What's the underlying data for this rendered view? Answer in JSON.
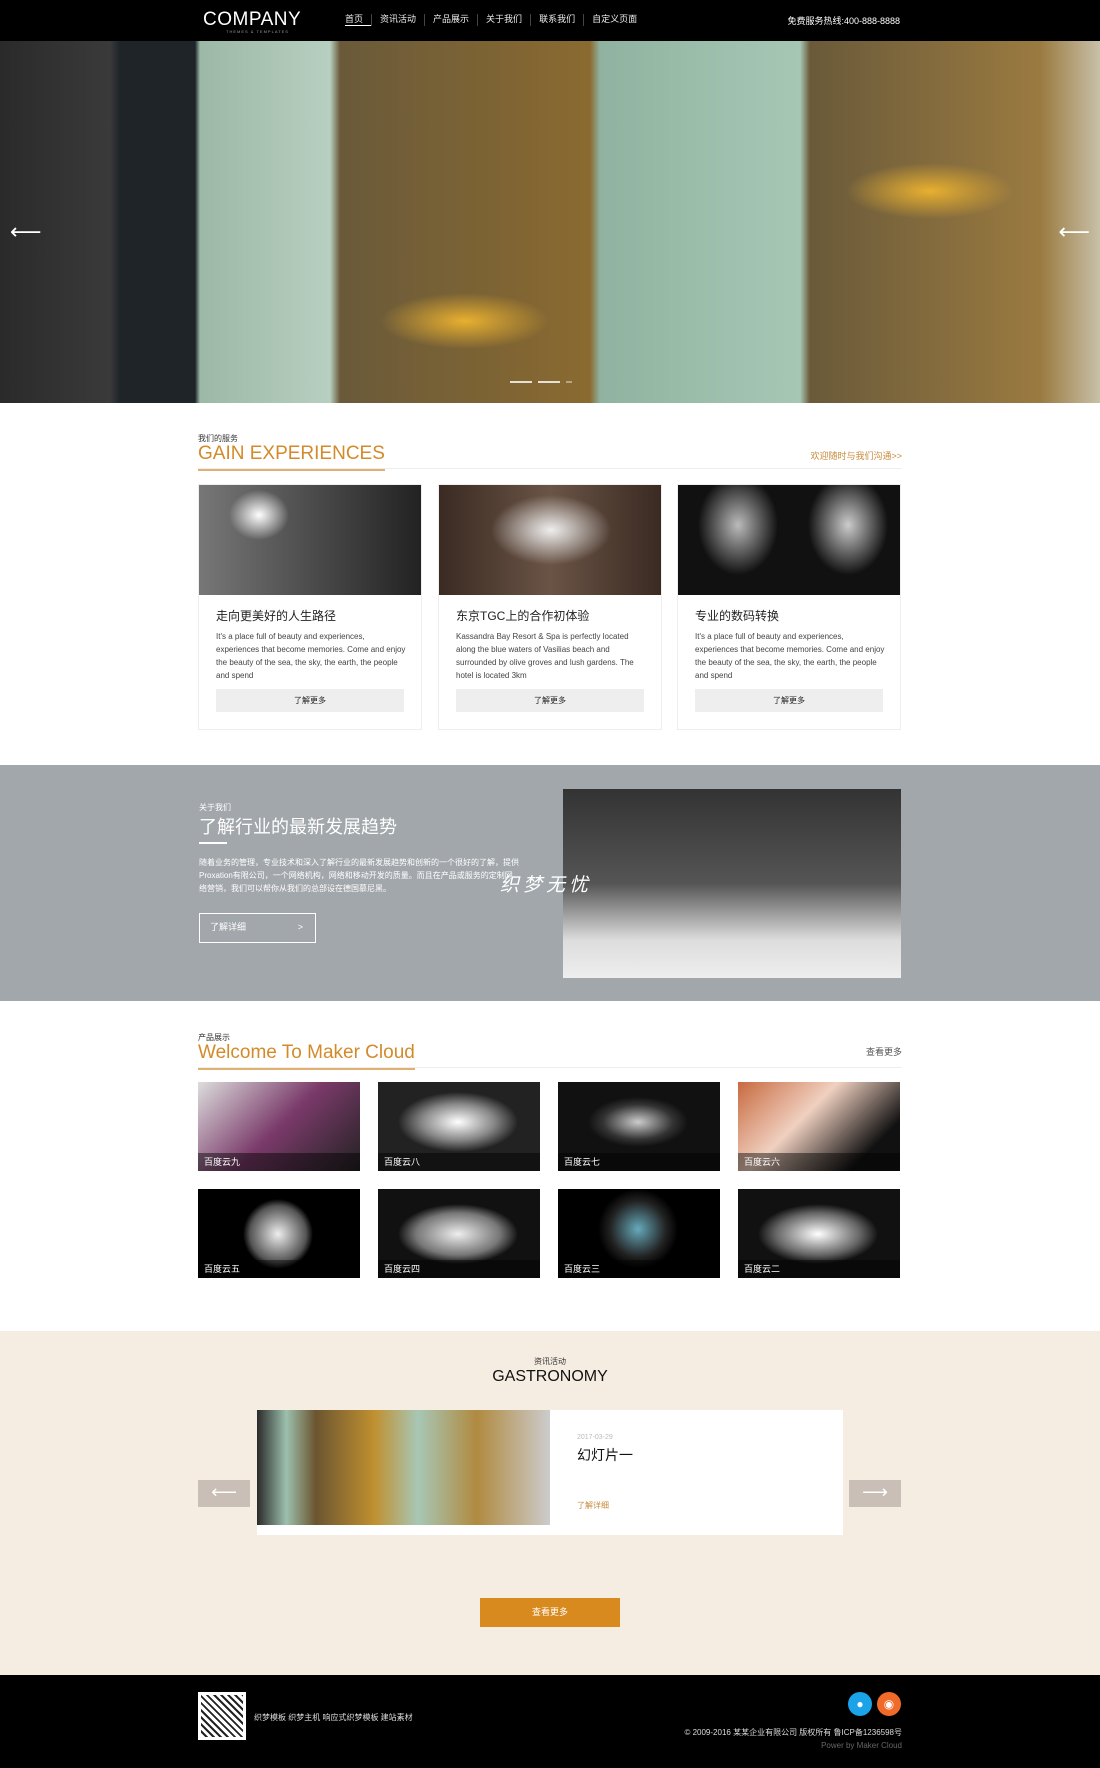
{
  "header": {
    "logo": "COMPANY",
    "logo_tagline": "THEMES & TEMPLATES",
    "nav": [
      "首页",
      "资讯活动",
      "产品展示",
      "关于我们",
      "联系我们",
      "自定义页面"
    ],
    "hotline": "免费服务热线:400-888-8888"
  },
  "hero": {
    "prev_icon": "arrow-left",
    "next_icon": "arrow-right",
    "slides": 3,
    "active_slide": 1
  },
  "services": {
    "subtitle": "我们的服务",
    "title": "GAIN EXPERIENCES",
    "link": "欢迎随时与我们沟通>>",
    "cards": [
      {
        "title": "走向更美好的人生路径",
        "text": "It's a place full of beauty and experiences, experiences that become memories. Come and enjoy the beauty of the sea, the sky, the earth, the people and spend",
        "button": "了解更多"
      },
      {
        "title": "东京TGC上的合作初体验",
        "text": "Kassandra Bay Resort & Spa is perfectly located along the blue waters of Vasilias beach and surrounded by olive groves and lush gardens. The hotel is located 3km",
        "button": "了解更多"
      },
      {
        "title": "专业的数码转换",
        "text": "It's a place full of beauty and experiences, experiences that become memories. Come and enjoy the beauty of the sea, the sky, the earth, the people and spend",
        "button": "了解更多"
      }
    ]
  },
  "about": {
    "subtitle": "关于我们",
    "title": "了解行业的最新发展趋势",
    "text": "随着业务的管理，专业技术和深入了解行业的最新发展趋势和创新的一个很好的了解，提供Proxation有限公司，一个网络机构，网络和移动开发的质量。而且在产品或服务的定制网络营销，我们可以帮你从我们的总部设在德国慕尼黑。",
    "button": "了解详细",
    "button_arrow": ">",
    "watermark": "织梦无忧"
  },
  "products": {
    "subtitle": "产品展示",
    "title": "Welcome To Maker Cloud",
    "link": "查看更多",
    "items": [
      "百度云九",
      "百度云八",
      "百度云七",
      "百度云六",
      "百度云五",
      "百度云四",
      "百度云三",
      "百度云二"
    ]
  },
  "news": {
    "subtitle": "资讯活动",
    "title": "GASTRONOMY",
    "date": "2017-03-29",
    "item_title": "幻灯片一",
    "item_link": "了解详细",
    "prev": "⟵",
    "next": "⟶",
    "more": "查看更多"
  },
  "footer": {
    "links": "织梦模板 织梦主机 响应式织梦模板 建站素材",
    "copyright": "© 2009-2016 某某企业有限公司 版权所有 鲁ICP备1236598号",
    "power": "Power by Maker Cloud",
    "social": [
      {
        "icon": "qq",
        "color": "#1aa3e8"
      },
      {
        "icon": "weibo",
        "color": "#f06a2a"
      }
    ]
  },
  "colors": {
    "accent": "#d98a1f",
    "about_bg": "#a2a7ab",
    "news_bg": "#f5ede2"
  }
}
